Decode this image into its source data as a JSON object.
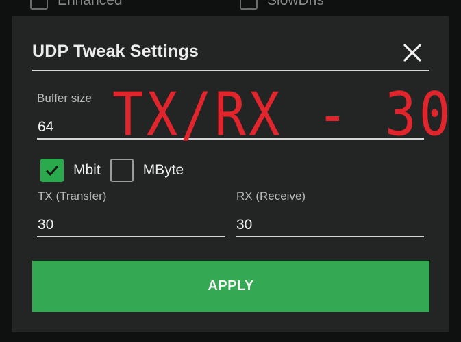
{
  "background_options": [
    {
      "label": "Enhanced",
      "checked": false
    },
    {
      "label": "SlowDns",
      "checked": false
    }
  ],
  "dialog": {
    "title": "UDP Tweak Settings",
    "close_icon": "close-icon",
    "buffer": {
      "label": "Buffer size",
      "value": "64"
    },
    "overlay_annotation": "TX/RX - 30",
    "units": [
      {
        "label": "Mbit",
        "checked": true
      },
      {
        "label": "MByte",
        "checked": false
      }
    ],
    "tx": {
      "label": "TX (Transfer)",
      "value": "30"
    },
    "rx": {
      "label": "RX (Receive)",
      "value": "30"
    },
    "apply_label": "APPLY"
  },
  "colors": {
    "accent_green": "#34a853",
    "overlay_red": "#e1252c",
    "dialog_bg": "#232424"
  }
}
